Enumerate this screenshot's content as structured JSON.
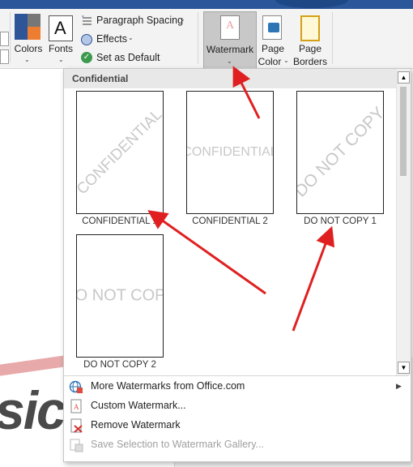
{
  "ribbon": {
    "colors_label": "Colors",
    "fonts_label": "Fonts",
    "fonts_glyph": "A",
    "paragraph_spacing": "Paragraph Spacing",
    "effects": "Effects",
    "set_as_default": "Set as Default",
    "watermark_label": "Watermark",
    "page_color_line1": "Page",
    "page_color_line2": "Color",
    "page_borders_line1": "Page",
    "page_borders_line2": "Borders",
    "chevron": "⌄"
  },
  "gallery": {
    "section_header": "Confidential",
    "tiles": [
      {
        "label": "CONFIDENTIAL 1",
        "watermark": "CONFIDENTIAL"
      },
      {
        "label": "CONFIDENTIAL 2",
        "watermark": "CONFIDENTIAL"
      },
      {
        "label": "DO NOT COPY 1",
        "watermark": "DO NOT COPY"
      },
      {
        "label": "DO NOT COPY 2",
        "watermark": "DO NOT COPY"
      }
    ]
  },
  "menu": {
    "more_watermarks": "More Watermarks from Office.com",
    "custom_watermark": "Custom Watermark...",
    "remove_watermark": "Remove Watermark",
    "save_selection": "Save Selection to Watermark Gallery..."
  },
  "colors": {
    "accent_red": "#e02020",
    "ribbon_bg": "#f3f3f3",
    "watermark_button_bg": "#c8c8c8",
    "disabled_text": "#a0a0a0"
  }
}
